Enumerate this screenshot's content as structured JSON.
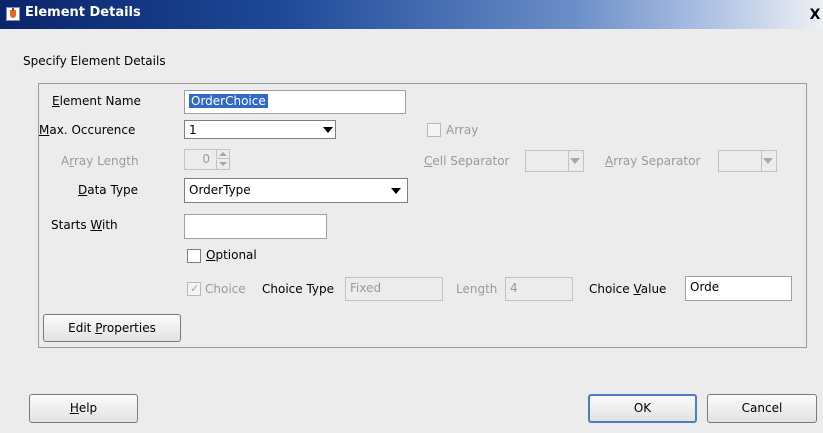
{
  "window": {
    "title": "Element Details",
    "icon": "java-cup-icon",
    "close_label": "X"
  },
  "section_title": "Specify Element Details",
  "element_name": {
    "label_prefix": "",
    "label_mnemonic": "E",
    "label_rest": "lement Name",
    "value": "OrderChoice"
  },
  "max_occurrence": {
    "label_mnemonic": "M",
    "label_rest": "ax. Occurence",
    "value": "1"
  },
  "array": {
    "label": "Array",
    "checked": false,
    "enabled": false
  },
  "array_length": {
    "label_prefix": "A",
    "label_mnemonic": "r",
    "label_rest": "ray Length",
    "value": "0"
  },
  "cell_separator": {
    "label_mnemonic": "C",
    "label_rest": "ell Separator",
    "value": ""
  },
  "array_separator": {
    "label_mnemonic": "A",
    "label_rest": "rray Separator",
    "value": ""
  },
  "data_type": {
    "label_mnemonic": "D",
    "label_rest": "ata Type",
    "value": "OrderType"
  },
  "starts_with": {
    "label_prefix": "Starts ",
    "label_mnemonic": "W",
    "label_rest": "ith",
    "value": ""
  },
  "optional": {
    "label_mnemonic": "O",
    "label_rest": "ptional",
    "checked": false
  },
  "choice": {
    "label": "Choice",
    "checked": true,
    "enabled": false
  },
  "choice_type": {
    "label": "Choice Type",
    "value": "Fixed"
  },
  "length": {
    "label": "Length",
    "value": "4"
  },
  "choice_value": {
    "label_prefix": "Choice ",
    "label_mnemonic": "V",
    "label_rest": "alue",
    "value": "Orde"
  },
  "buttons": {
    "edit_properties": {
      "prefix": "Edit ",
      "mnemonic": "P",
      "rest": "roperties"
    },
    "help": {
      "prefix": "",
      "mnemonic": "H",
      "rest": "elp"
    },
    "ok": "OK",
    "cancel": "Cancel"
  }
}
